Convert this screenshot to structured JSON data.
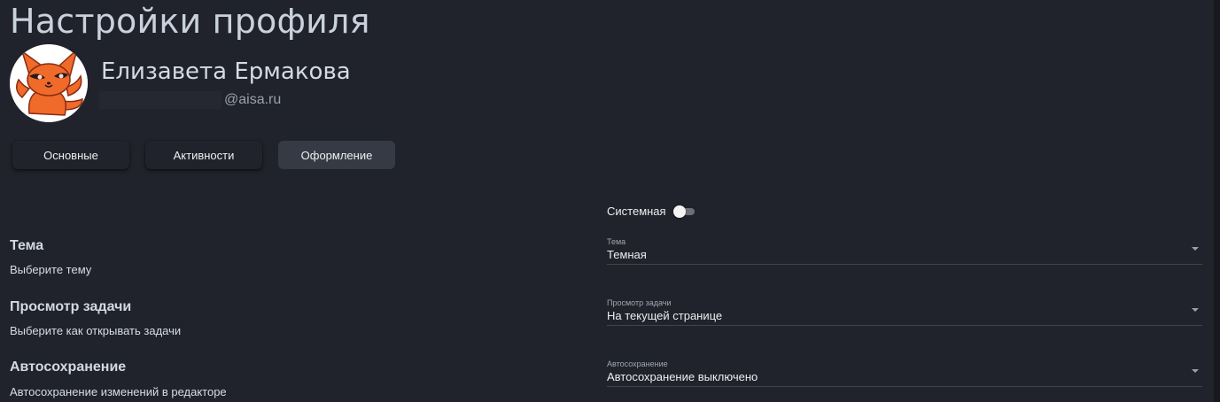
{
  "page": {
    "title": "Настройки профиля"
  },
  "profile": {
    "name": "Елизавета Ермакова",
    "email_domain": "@aisa.ru"
  },
  "tabs": [
    {
      "label": "Основные",
      "active": false
    },
    {
      "label": "Активности",
      "active": false
    },
    {
      "label": "Оформление",
      "active": true
    }
  ],
  "system_toggle": {
    "label": "Системная",
    "on": false
  },
  "settings": {
    "theme": {
      "title": "Тема",
      "description": "Выберите тему",
      "select_label": "Тема",
      "select_value": "Темная"
    },
    "task_view": {
      "title": "Просмотр задачи",
      "description": "Выберите как открывать задачи",
      "select_label": "Просмотр задачи",
      "select_value": "На текущей странице"
    },
    "autosave": {
      "title": "Автосохранение",
      "description": "Автосохранение изменений в редакторе",
      "select_label": "Автосохранение",
      "select_value": "Автосохранение выключено"
    }
  },
  "colors": {
    "background": "#20232b",
    "active_tab": "#363a44",
    "avatar_fox": "#f06a2a"
  },
  "icons": {
    "avatar": "fox-avatar-icon",
    "dropdown": "chevron-down-icon"
  }
}
